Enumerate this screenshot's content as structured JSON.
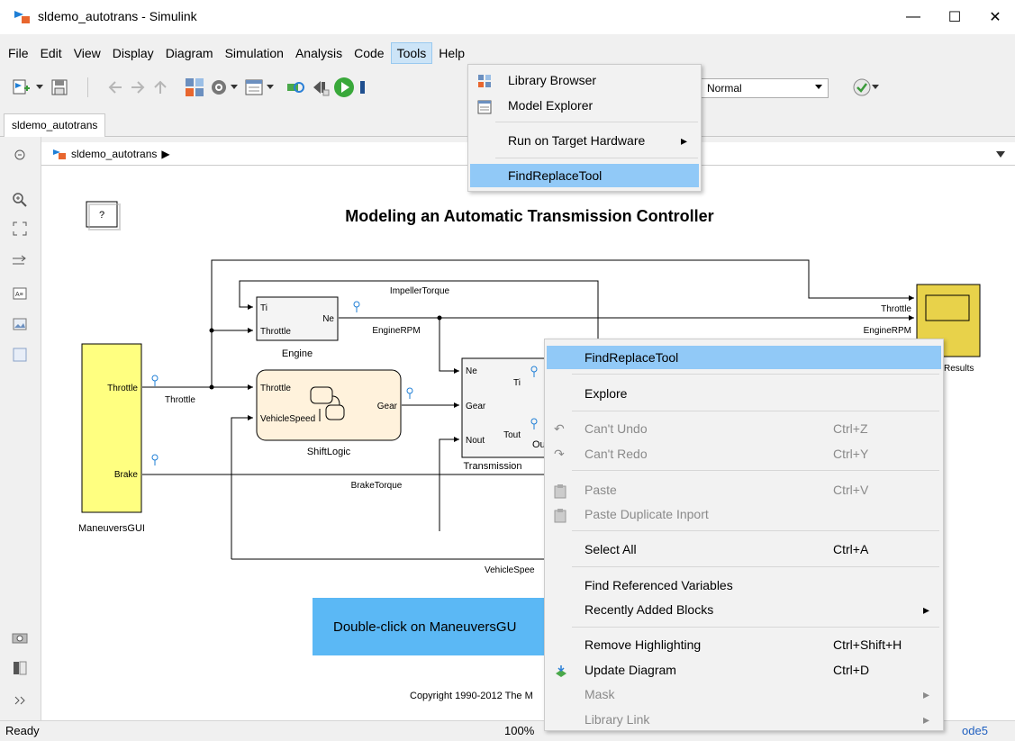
{
  "window": {
    "title": "sldemo_autotrans - Simulink",
    "minimize": "—",
    "maximize": "☐",
    "close": "✕"
  },
  "menubar": [
    "File",
    "Edit",
    "View",
    "Display",
    "Diagram",
    "Simulation",
    "Analysis",
    "Code",
    "Tools",
    "Help"
  ],
  "toolbar": {
    "sim_mode": "Normal"
  },
  "tab": {
    "label": "sldemo_autotrans"
  },
  "breadcrumb": {
    "label": "sldemo_autotrans",
    "arrow": "▶"
  },
  "diagram": {
    "help_block": "?",
    "title": "Modeling an Automatic Transmission Controller",
    "blocks": {
      "engine": {
        "name": "Engine",
        "in1": "Ti",
        "in2": "Throttle",
        "out1": "Ne"
      },
      "shiftlogic": {
        "name": "ShiftLogic",
        "in1": "Throttle",
        "in2": "VehicleSpeed",
        "out1": "Gear"
      },
      "transmission": {
        "name": "Transmission",
        "in1": "Ne",
        "in2": "Gear",
        "in3": "Nout",
        "out1": "Ti",
        "out2": "Tout",
        "out2_clip": "Out"
      },
      "maneuvers": {
        "name": "ManeuversGUI",
        "out1": "Throttle",
        "out2": "Brake"
      },
      "results": {
        "name": "Results",
        "in1": "Throttle",
        "in2": "EngineRPM",
        "name_clip": "Results"
      }
    },
    "signals": {
      "impeller": "ImpellerTorque",
      "engine_rpm": "EngineRPM",
      "throttle": "Throttle",
      "brake_torque": "BrakeTorque",
      "vehicle_speed": "VehicleSpee"
    },
    "banner": "Double-click on ManeuversGU",
    "copyright": "Copyright 1990-2012 The M"
  },
  "status": {
    "left": "Ready",
    "zoom": "100%",
    "solver": "ode5"
  },
  "tools_menu": {
    "items": [
      {
        "label": "Library Browser"
      },
      {
        "label": "Model Explorer"
      },
      {
        "label": "Run on Target Hardware"
      },
      {
        "label": "FindReplaceTool"
      }
    ]
  },
  "context_menu": {
    "items": [
      {
        "label": "FindReplaceTool"
      },
      {
        "label": "Explore"
      },
      {
        "label": "Can't Undo",
        "shortcut": "Ctrl+Z"
      },
      {
        "label": "Can't Redo",
        "shortcut": "Ctrl+Y"
      },
      {
        "label": "Paste",
        "shortcut": "Ctrl+V"
      },
      {
        "label": "Paste Duplicate Inport"
      },
      {
        "label": "Select All",
        "shortcut": "Ctrl+A"
      },
      {
        "label": "Find Referenced Variables"
      },
      {
        "label": "Recently Added Blocks"
      },
      {
        "label": "Remove Highlighting",
        "shortcut": "Ctrl+Shift+H"
      },
      {
        "label": "Update Diagram",
        "shortcut": "Ctrl+D"
      },
      {
        "label": "Mask"
      },
      {
        "label": "Library Link"
      }
    ]
  },
  "colors": {
    "highlight": "#91c9f7",
    "maneuvers_fill": "#ffff80",
    "results_fill": "#e8d24a",
    "chart_fill": "#fff2dc",
    "banner_fill": "#5bb8f5"
  }
}
